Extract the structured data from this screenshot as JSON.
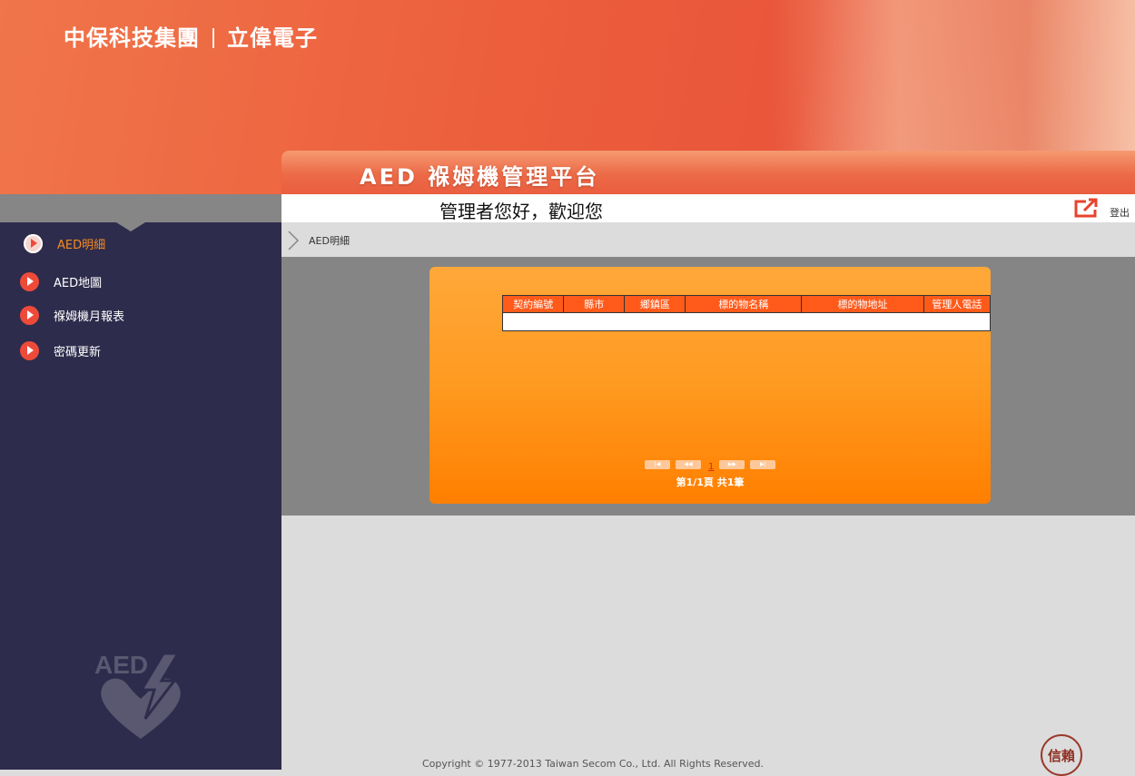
{
  "header": {
    "company_left": "中保科技集團",
    "company_right": "立偉電子",
    "app_title": "AED 褓姆機管理平台"
  },
  "topbar": {
    "welcome": "管理者您好，歡迎您",
    "logout_label": "登出"
  },
  "sidebar": {
    "items": [
      {
        "label": "AED明細",
        "active": true
      },
      {
        "label": "AED地圖",
        "active": false
      },
      {
        "label": "褓姆機月報表",
        "active": false
      },
      {
        "label": "密碼更新",
        "active": false
      }
    ],
    "logo_text": "AED"
  },
  "breadcrumb": "AED明細",
  "table": {
    "columns": [
      "契約編號",
      "縣市",
      "鄉鎮區",
      "標的物名稱",
      "標的物地址",
      "管理人電話"
    ],
    "rows": [
      [
        "",
        "",
        "",
        "",
        "",
        ""
      ]
    ]
  },
  "pager": {
    "current_page": "1",
    "info": "第1/1頁 共1筆",
    "buttons": [
      "first-page-icon",
      "prev-page-icon",
      "next-page-icon",
      "last-page-icon"
    ]
  },
  "footer": {
    "copyright": "Copyright © 1977-2013 Taiwan Secom Co., Ltd. All Rights Reserved.",
    "seal_text": "信賴"
  },
  "colors": {
    "header_orange": "#ec5e3c",
    "sidebar_bg": "#2e2c4c",
    "table_header": "#ff5a1a",
    "panel_orange": "#ff9a20",
    "nav_active": "#f78b1f"
  }
}
